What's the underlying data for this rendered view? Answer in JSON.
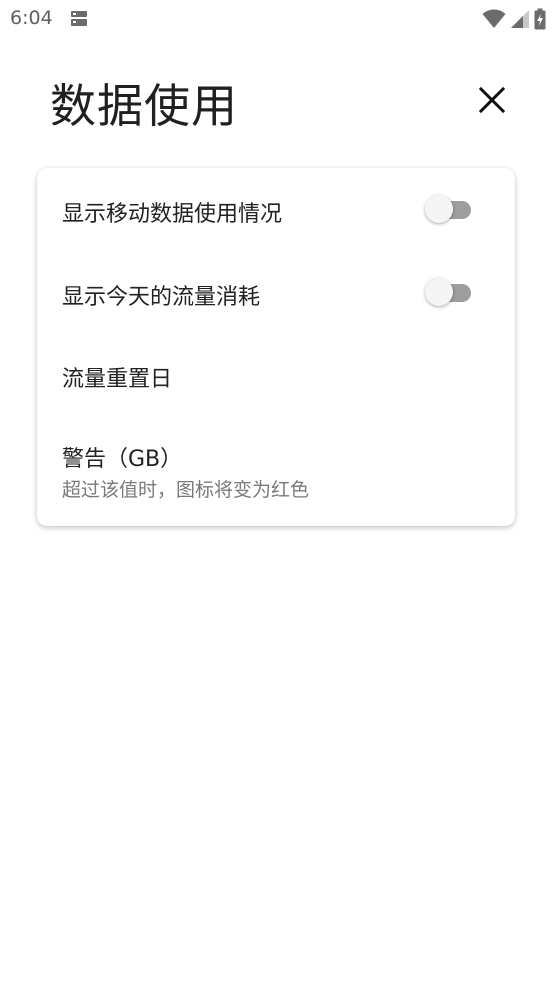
{
  "status_bar": {
    "time": "6:04",
    "icons": [
      "sim-card-icon",
      "wifi-icon",
      "cellular-signal-icon",
      "battery-charging-icon"
    ]
  },
  "header": {
    "title": "数据使用",
    "close_icon": "close-icon"
  },
  "settings": {
    "items": [
      {
        "label": "显示移动数据使用情况",
        "type": "switch",
        "checked": false
      },
      {
        "label": "显示今天的流量消耗",
        "type": "switch",
        "checked": false
      },
      {
        "label": "流量重置日",
        "type": "item"
      },
      {
        "label": "警告（GB）",
        "summary": "超过该值时，图标将变为红色",
        "type": "item"
      }
    ]
  },
  "colors": {
    "switch_track_off": "#9e9e9e",
    "switch_thumb_off": "#f5f5f5",
    "text_primary": "#222222",
    "text_secondary": "#7a7a7a"
  }
}
